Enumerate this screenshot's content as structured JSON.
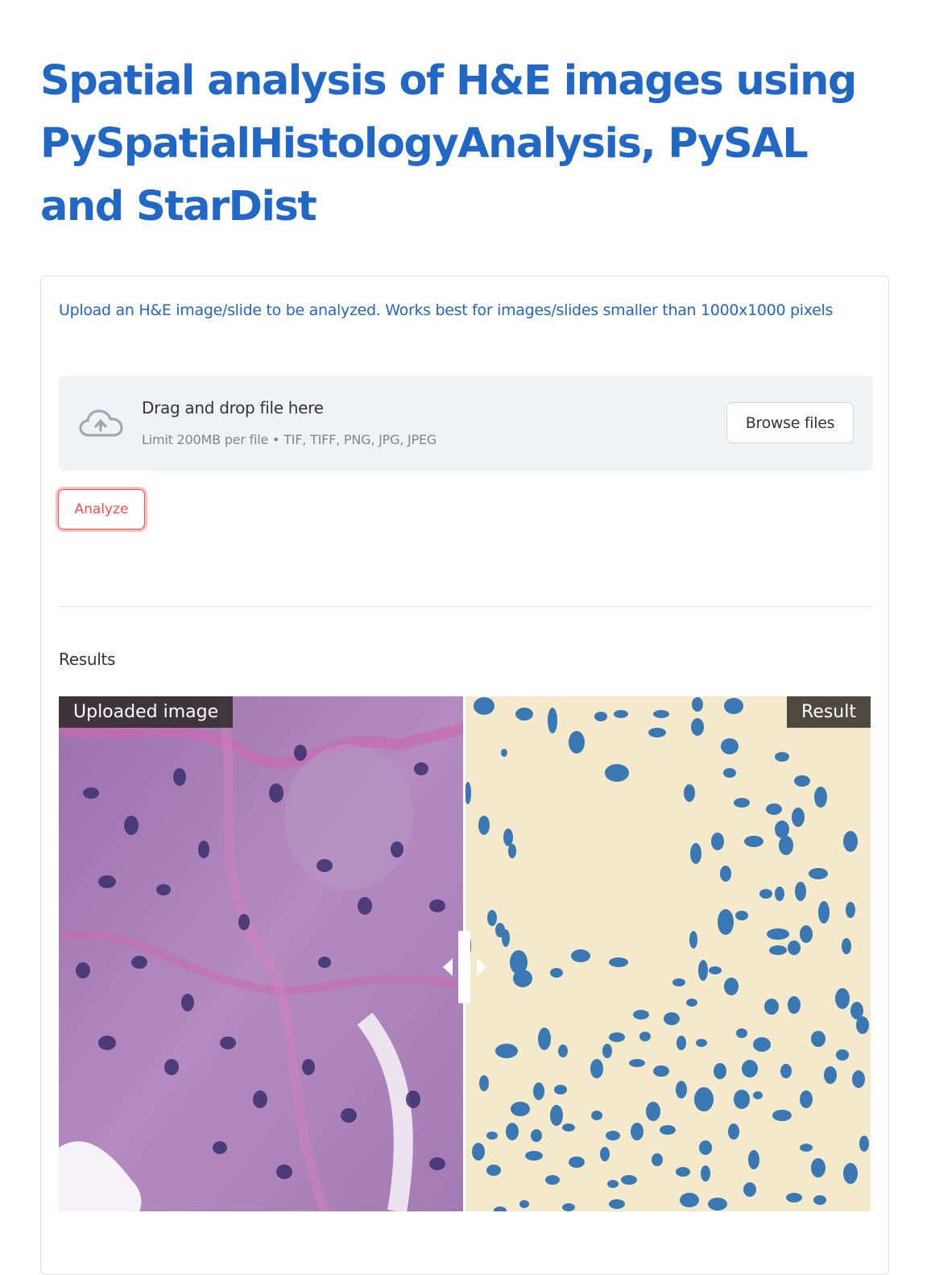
{
  "page": {
    "title": "Spatial analysis of H&E images using PySpatialHistologyAnalysis, PySAL and StarDist"
  },
  "upload": {
    "instructions": "Upload an H&E image/slide to be analyzed. Works best for images/slides smaller than 1000x1000 pixels",
    "drop_text": "Drag and drop file here",
    "limit_text": "Limit 200MB per file • TIF, TIFF, PNG, JPG, JPEG",
    "browse_label": "Browse files",
    "icon": "cloud-upload-icon"
  },
  "actions": {
    "analyze_label": "Analyze"
  },
  "results": {
    "heading": "Results",
    "left_label": "Uploaded image",
    "right_label": "Result",
    "slider_position": 0.5
  },
  "colors": {
    "title": "#2167c6",
    "accent": "#ff4b4b",
    "dropzone_bg": "#f0f2f6",
    "result_bg": "#f5e9cb",
    "nucleus": "#3a78b4",
    "tissue": "#a77eb6"
  }
}
